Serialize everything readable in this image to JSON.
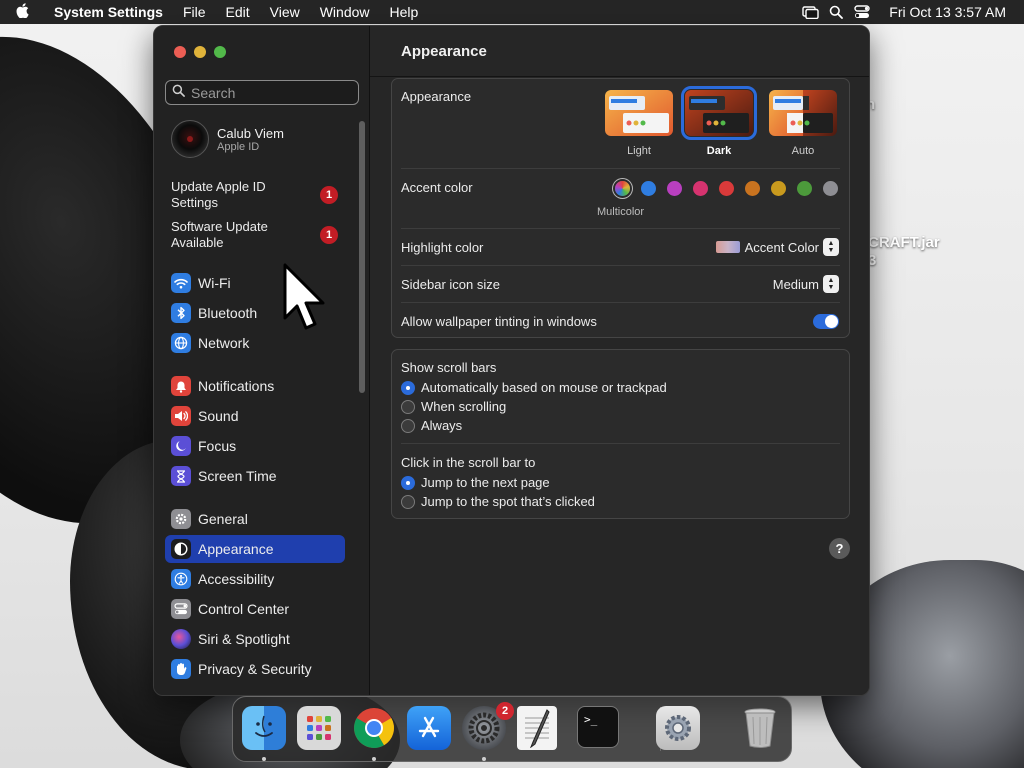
{
  "menubar": {
    "app_name": "System Settings",
    "menus": [
      "File",
      "Edit",
      "View",
      "Window",
      "Help"
    ],
    "clock": "Fri Oct 13  3:57 AM",
    "status_icons": [
      "screen-mirroring-icon",
      "search-icon",
      "control-center-icon"
    ]
  },
  "desktop": {
    "file_label": "CRAFT.jar",
    "label_partial_1": "n",
    "label_partial_2": "3"
  },
  "sidebar": {
    "search_placeholder": "Search",
    "account": {
      "name": "Calub Viem",
      "subtitle": "Apple ID"
    },
    "notices": [
      {
        "label": "Update Apple ID Settings",
        "badge": "1"
      },
      {
        "label": "Software Update Available",
        "badge": "1"
      }
    ],
    "items": [
      {
        "label": "Wi-Fi",
        "icon": "wifi-icon",
        "color": "#2f7de1"
      },
      {
        "label": "Bluetooth",
        "icon": "bluetooth-icon",
        "color": "#2f7de1"
      },
      {
        "label": "Network",
        "icon": "globe-icon",
        "color": "#2f7de1"
      },
      {
        "label": "Notifications",
        "icon": "bell-icon",
        "color": "#e0443b"
      },
      {
        "label": "Sound",
        "icon": "speaker-icon",
        "color": "#e0443b"
      },
      {
        "label": "Focus",
        "icon": "moon-icon",
        "color": "#5b4fd6"
      },
      {
        "label": "Screen Time",
        "icon": "hourglass-icon",
        "color": "#5b4fd6"
      },
      {
        "label": "General",
        "icon": "gear-icon",
        "color": "#8e8e93"
      },
      {
        "label": "Appearance",
        "icon": "appearance-icon",
        "color": "#1c1c1e",
        "active": true
      },
      {
        "label": "Accessibility",
        "icon": "accessibility-icon",
        "color": "#2f7de1"
      },
      {
        "label": "Control Center",
        "icon": "control-center-icon",
        "color": "#8e8e93"
      },
      {
        "label": "Siri & Spotlight",
        "icon": "siri-icon",
        "color": "#3a2f6b"
      },
      {
        "label": "Privacy & Security",
        "icon": "hand-icon",
        "color": "#2f7de1"
      }
    ]
  },
  "main": {
    "title": "Appearance",
    "appearance": {
      "label": "Appearance",
      "options": [
        {
          "label": "Light",
          "selected": false
        },
        {
          "label": "Dark",
          "selected": true
        },
        {
          "label": "Auto",
          "selected": false
        }
      ]
    },
    "accent": {
      "label": "Accent color",
      "selected_caption": "Multicolor",
      "colors": [
        "multicolor",
        "#2f7de1",
        "#b83fbf",
        "#d6336f",
        "#d93a3a",
        "#c9731f",
        "#c99a1e",
        "#4c9a3b",
        "#8e8e93"
      ]
    },
    "highlight": {
      "label": "Highlight color",
      "value": "Accent Color"
    },
    "sidebar_icon_size": {
      "label": "Sidebar icon size",
      "value": "Medium"
    },
    "wallpaper_tinting": {
      "label": "Allow wallpaper tinting in windows",
      "enabled": true
    },
    "scroll_bars": {
      "label": "Show scroll bars",
      "options": [
        {
          "label": "Automatically based on mouse or trackpad",
          "selected": true
        },
        {
          "label": "When scrolling",
          "selected": false
        },
        {
          "label": "Always",
          "selected": false
        }
      ]
    },
    "click_scroll": {
      "label": "Click in the scroll bar to",
      "options": [
        {
          "label": "Jump to the next page",
          "selected": true
        },
        {
          "label": "Jump to the spot that’s clicked",
          "selected": false
        }
      ]
    },
    "help_label": "?"
  },
  "dock": {
    "items": [
      {
        "name": "Finder",
        "icon": "finder-icon"
      },
      {
        "name": "Launchpad",
        "icon": "launchpad-icon"
      },
      {
        "name": "Chrome",
        "icon": "chrome-icon"
      },
      {
        "name": "App Store",
        "icon": "app-store-icon"
      },
      {
        "name": "System Settings",
        "icon": "system-settings-icon",
        "badge": "2"
      },
      {
        "name": "TextEdit",
        "icon": "textedit-icon"
      },
      {
        "name": "Terminal",
        "icon": "terminal-icon",
        "glyph": ">_"
      },
      {
        "name": "Utility",
        "icon": "gear-app-icon"
      },
      {
        "name": "Trash",
        "icon": "trash-icon"
      }
    ]
  }
}
